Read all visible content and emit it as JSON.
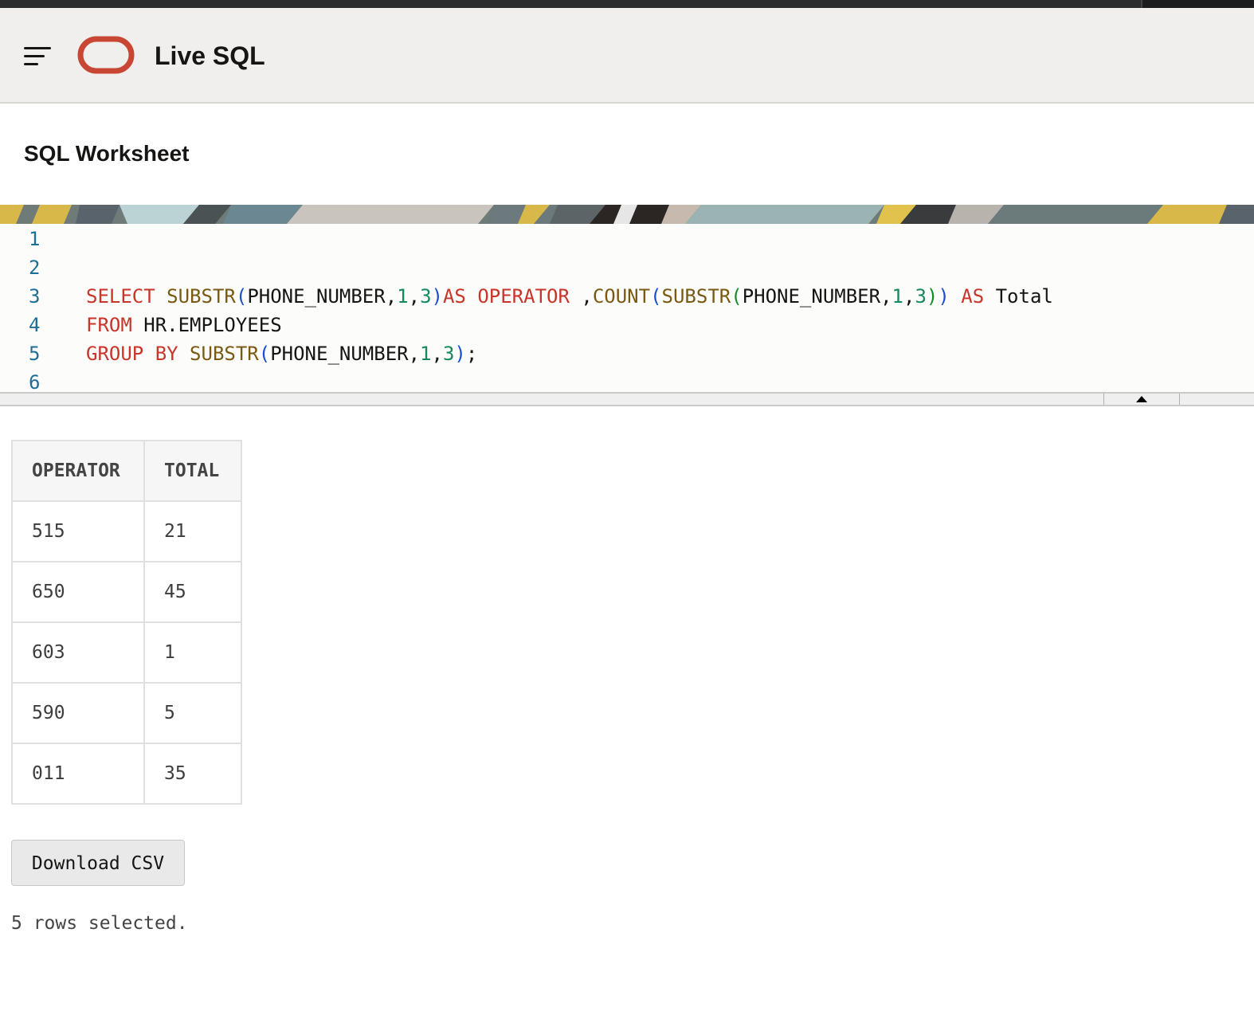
{
  "app": {
    "title": "Live SQL",
    "brand_color": "#c74634"
  },
  "worksheet": {
    "title": "SQL Worksheet"
  },
  "editor": {
    "lines": [
      {
        "number": "1",
        "tokens": []
      },
      {
        "number": "2",
        "tokens": []
      },
      {
        "number": "3",
        "tokens": [
          {
            "t": "SELECT",
            "c": "kw"
          },
          {
            "t": " ",
            "c": ""
          },
          {
            "t": "SUBSTR",
            "c": "fn"
          },
          {
            "t": "(",
            "c": "par1"
          },
          {
            "t": "PHONE_NUMBER,",
            "c": ""
          },
          {
            "t": "1",
            "c": "num"
          },
          {
            "t": ",",
            "c": ""
          },
          {
            "t": "3",
            "c": "num"
          },
          {
            "t": ")",
            "c": "par1"
          },
          {
            "t": "AS",
            "c": "kw"
          },
          {
            "t": " ",
            "c": ""
          },
          {
            "t": "OPERATOR",
            "c": "kw"
          },
          {
            "t": " ,",
            "c": ""
          },
          {
            "t": "COUNT",
            "c": "fn"
          },
          {
            "t": "(",
            "c": "par1"
          },
          {
            "t": "SUBSTR",
            "c": "fn"
          },
          {
            "t": "(",
            "c": "par2"
          },
          {
            "t": "PHONE_NUMBER,",
            "c": ""
          },
          {
            "t": "1",
            "c": "num"
          },
          {
            "t": ",",
            "c": ""
          },
          {
            "t": "3",
            "c": "num"
          },
          {
            "t": ")",
            "c": "par2"
          },
          {
            "t": ")",
            "c": "par1"
          },
          {
            "t": " ",
            "c": ""
          },
          {
            "t": "AS",
            "c": "kw"
          },
          {
            "t": " Total",
            "c": ""
          }
        ]
      },
      {
        "number": "4",
        "tokens": [
          {
            "t": "FROM",
            "c": "kw"
          },
          {
            "t": " HR.EMPLOYEES",
            "c": ""
          }
        ]
      },
      {
        "number": "5",
        "tokens": [
          {
            "t": "GROUP BY",
            "c": "kw"
          },
          {
            "t": " ",
            "c": ""
          },
          {
            "t": "SUBSTR",
            "c": "fn"
          },
          {
            "t": "(",
            "c": "par1"
          },
          {
            "t": "PHONE_NUMBER,",
            "c": ""
          },
          {
            "t": "1",
            "c": "num"
          },
          {
            "t": ",",
            "c": ""
          },
          {
            "t": "3",
            "c": "num"
          },
          {
            "t": ")",
            "c": "par1"
          },
          {
            "t": ";",
            "c": ""
          }
        ]
      },
      {
        "number": "6",
        "tokens": []
      }
    ]
  },
  "results": {
    "columns": [
      "OPERATOR",
      "TOTAL"
    ],
    "rows": [
      [
        "515",
        "21"
      ],
      [
        "650",
        "45"
      ],
      [
        "603",
        "1"
      ],
      [
        "590",
        "5"
      ],
      [
        "011",
        "35"
      ]
    ],
    "download_label": "Download CSV",
    "status": "5 rows selected."
  },
  "icons": {
    "menu": "hamburger-menu-icon",
    "logo": "oracle-logo-icon",
    "collapse": "caret-up-icon"
  }
}
